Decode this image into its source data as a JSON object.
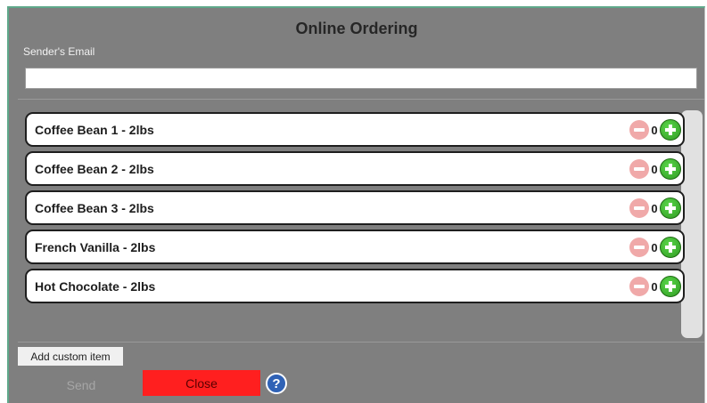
{
  "dialog": {
    "title": "Online Ordering",
    "email_label": "Sender's Email",
    "email_value": "",
    "email_placeholder": ""
  },
  "items": [
    {
      "label": "Coffee Bean 1 - 2lbs",
      "quantity": "0"
    },
    {
      "label": "Coffee Bean 2 - 2lbs",
      "quantity": "0"
    },
    {
      "label": "Coffee Bean 3 - 2lbs",
      "quantity": "0"
    },
    {
      "label": "French Vanilla - 2lbs",
      "quantity": "0"
    },
    {
      "label": "Hot Chocolate - 2lbs",
      "quantity": "0"
    }
  ],
  "footer": {
    "add_custom_label": "Add custom item",
    "send_label": "Send",
    "close_label": "Close",
    "help_glyph": "?"
  },
  "colors": {
    "dialog_bg": "#7f7f7f",
    "close_button": "#ff1f1f",
    "plus_button": "#3cab2c",
    "minus_button": "#f0a9a9",
    "help_icon": "#2f62b6"
  },
  "icons": {
    "increment": "plus-circle-icon",
    "decrement": "minus-circle-icon",
    "help": "question-circle-icon"
  }
}
